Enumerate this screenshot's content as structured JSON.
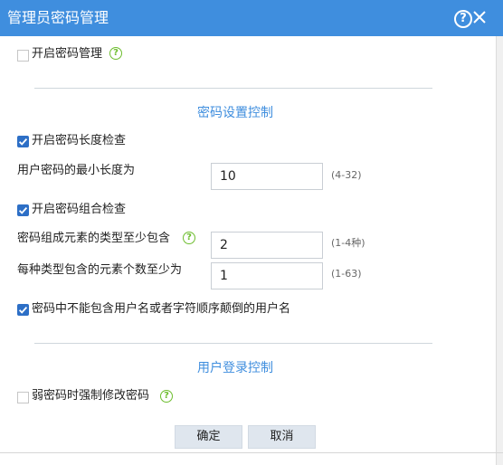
{
  "dialog": {
    "title": "管理员密码管理",
    "help_icon": "help-circle-icon",
    "close_icon": "close-icon",
    "accent_color": "#3f8ede"
  },
  "options": {
    "enable_password_management": {
      "label": "开启密码管理",
      "checked": false,
      "hint_icon": "question-circle-icon"
    },
    "enable_length_check": {
      "label": "开启密码长度检查",
      "checked": true
    },
    "enable_combination_check": {
      "label": "开启密码组合检查",
      "checked": true
    },
    "no_username": {
      "label": "密码中不能包含用户名或者字符顺序颠倒的用户名",
      "checked": true
    },
    "force_weak_change": {
      "label": "弱密码时强制修改密码",
      "checked": false,
      "hint_icon": "question-circle-icon"
    }
  },
  "sections": {
    "password_settings": "密码设置控制",
    "login_control": "用户登录控制"
  },
  "fields": {
    "min_length": {
      "label": "用户密码的最小长度为",
      "value": "10",
      "range": "(4-32)"
    },
    "min_types": {
      "label": "密码组成元素的类型至少包含",
      "value": "2",
      "range": "(1-4种)"
    },
    "min_per_type": {
      "label": "每种类型包含的元素个数至少为",
      "value": "1",
      "range": "(1-63)"
    }
  },
  "buttons": {
    "ok": "确定",
    "cancel": "取消"
  }
}
